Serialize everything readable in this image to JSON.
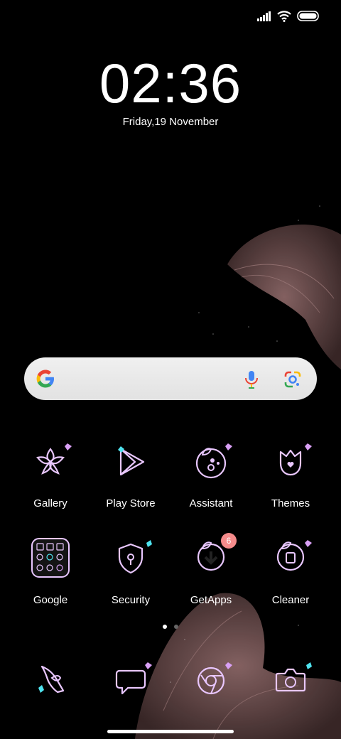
{
  "status_bar": {
    "signal": "signal-icon",
    "wifi": "wifi-icon",
    "battery": "battery-icon"
  },
  "clock": {
    "time": "02:36",
    "date": "Friday,19 November"
  },
  "search": {
    "google_icon": "google-icon",
    "mic_icon": "mic-icon",
    "lens_icon": "lens-icon"
  },
  "apps": [
    {
      "label": "Gallery",
      "icon": "gallery-icon"
    },
    {
      "label": "Play Store",
      "icon": "play-store-icon"
    },
    {
      "label": "Assistant",
      "icon": "assistant-icon"
    },
    {
      "label": "Themes",
      "icon": "themes-icon"
    },
    {
      "label": "Google",
      "icon": "google-folder-icon"
    },
    {
      "label": "Security",
      "icon": "security-icon"
    },
    {
      "label": "GetApps",
      "icon": "getapps-icon",
      "badge": "6"
    },
    {
      "label": "Cleaner",
      "icon": "cleaner-icon"
    }
  ],
  "dock": [
    {
      "icon": "phone-icon"
    },
    {
      "icon": "messages-icon"
    },
    {
      "icon": "chrome-icon"
    },
    {
      "icon": "camera-icon"
    }
  ],
  "page_indicator": {
    "pages": 2,
    "current": 1
  },
  "colors": {
    "neon": "#e9c7ff",
    "accent_pink": "#d9a0f5",
    "accent_cyan": "#4fe3ef",
    "badge": "#f58b8b"
  }
}
